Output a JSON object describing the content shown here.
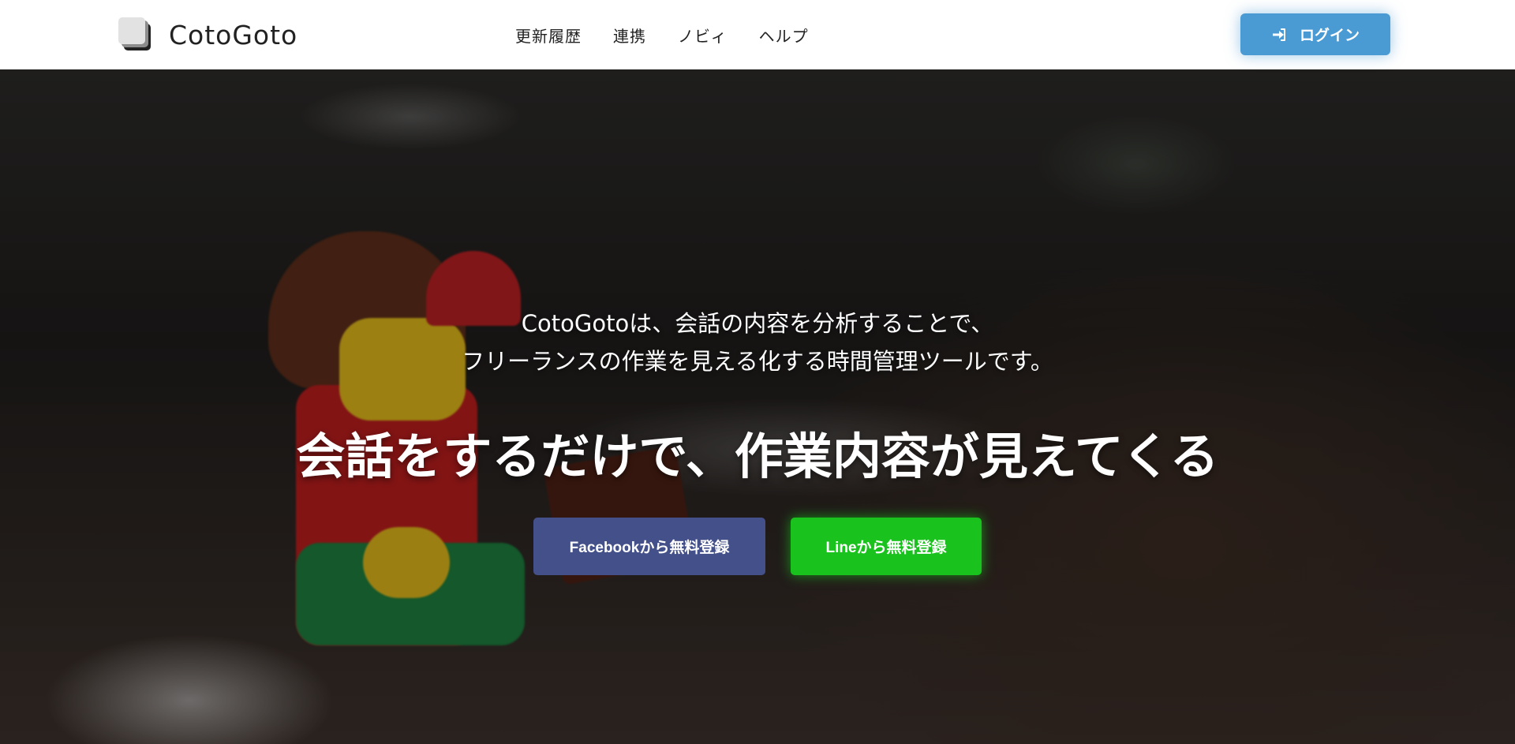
{
  "header": {
    "logo_text": "CotoGoto",
    "nav": [
      {
        "label": "更新履歴"
      },
      {
        "label": "連携"
      },
      {
        "label": "ノビィ"
      },
      {
        "label": "ヘルプ"
      }
    ],
    "login_label": "ログイン"
  },
  "hero": {
    "subtitle_line1": "CotoGotoは、会話の内容を分析することで、",
    "subtitle_line2": "フリーランスの作業を見える化する時間管理ツールです。",
    "headline": "会話をするだけで、作業内容が見えてくる",
    "facebook_cta": "Facebookから無料登録",
    "line_cta": "Lineから無料登録"
  },
  "colors": {
    "login_button": "#4a9ad3",
    "facebook_button": "#44508a",
    "line_button": "#19c21c"
  }
}
